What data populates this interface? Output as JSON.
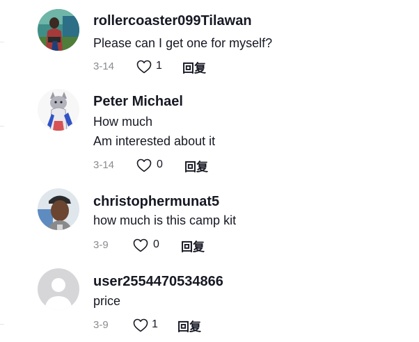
{
  "colors": {
    "text_primary": "#161823",
    "text_secondary": "#8a8b91",
    "background": "#ffffff"
  },
  "comments": [
    {
      "username": "rollercoaster099Tilawan",
      "text_lines": [
        "Please can I get one for myself?"
      ],
      "date": "3-14",
      "likes": "1",
      "reply_label": "回复",
      "avatar_icon": "user-photo-avatar"
    },
    {
      "username": "Peter Michael",
      "text_lines": [
        "How much",
        "Am interested about it"
      ],
      "date": "3-14",
      "likes": "0",
      "reply_label": "回复",
      "avatar_icon": "illustrated-cat-avatar"
    },
    {
      "username": "christophermunat5",
      "text_lines": [
        "how much is this camp kit"
      ],
      "date": "3-9",
      "likes": "0",
      "reply_label": "回复",
      "avatar_icon": "user-photo-avatar"
    },
    {
      "username": "user2554470534866",
      "text_lines": [
        "price"
      ],
      "date": "3-9",
      "likes": "1",
      "reply_label": "回复",
      "avatar_icon": "default-avatar"
    }
  ]
}
